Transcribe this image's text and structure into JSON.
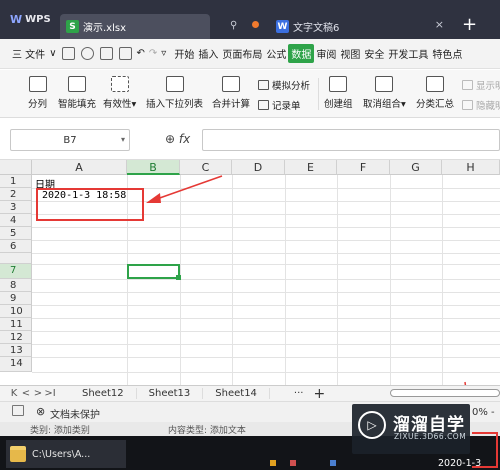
{
  "app": {
    "name": "WPS"
  },
  "tabs": [
    {
      "label": "演示.xlsx",
      "icon": "spreadsheet-file-icon",
      "color": "#2ea349"
    },
    {
      "label": "文字文稿6",
      "icon": "writer-file-icon",
      "color": "#3b6fe0"
    }
  ],
  "menu": {
    "file_label": "三 文件",
    "items": [
      "开始",
      "插入",
      "页面布局",
      "公式",
      "数据",
      "审阅",
      "视图",
      "安全",
      "开发工具",
      "特色点"
    ],
    "active_item": "数据"
  },
  "ribbon": {
    "split": "分列",
    "smart_fill": "智能填充",
    "validity": "有效性",
    "insert_dropdown": "插入下拉列表",
    "merge_calc": "合并计算",
    "simulate": "模拟分析",
    "record": "记录单",
    "create_group": "创建组",
    "ungroup": "取消组合",
    "subtotal": "分类汇总",
    "show_detail": "显示明",
    "hide_detail": "隐藏明"
  },
  "formula_bar": {
    "cell_ref": "B7",
    "fx": "fx"
  },
  "grid": {
    "columns": [
      "A",
      "B",
      "C",
      "D",
      "E",
      "F",
      "G",
      "H"
    ],
    "selected_column": "B",
    "rows": [
      "1",
      "2",
      "3",
      "4",
      "5",
      "6",
      "7",
      "8",
      "9",
      "10",
      "11",
      "12",
      "13",
      "14"
    ],
    "selected_row": "7",
    "cells": {
      "A1": "日期",
      "A2": "2020-1-3 18:58"
    }
  },
  "sheets": {
    "nav": [
      "K",
      "<",
      ">",
      ">I"
    ],
    "tabs": [
      "Sheet12",
      "Sheet13",
      "Sheet14"
    ],
    "more": "···",
    "add": "+"
  },
  "status": {
    "protect": "文档未保护",
    "zoom": "0% -"
  },
  "strip": {
    "category": "类别: 添加类别",
    "content_type": "内容类型: 添加文本"
  },
  "taskbar": {
    "path": "C:\\Users\\A...",
    "date": "2020-1-3"
  },
  "watermark": {
    "name": "溜溜自学",
    "url": "ZIXUE.3D66.COM"
  }
}
